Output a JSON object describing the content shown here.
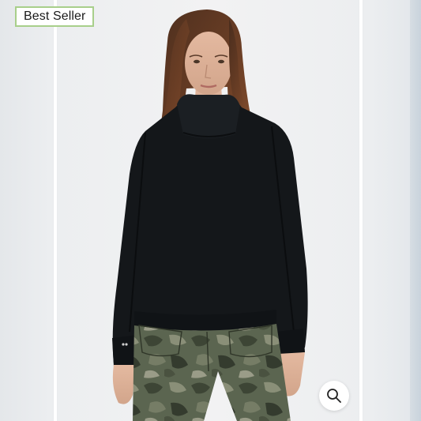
{
  "badge": {
    "label": "Best Seller"
  },
  "zoom": {
    "icon": "magnifier-icon"
  },
  "product": {
    "image": "model-wearing-black-mock-neck-sweatshirt-and-camo-pants"
  },
  "colors": {
    "badge_border": "#a8cf8b",
    "sweater": "#14171a",
    "camo_base": "#5b6550"
  }
}
